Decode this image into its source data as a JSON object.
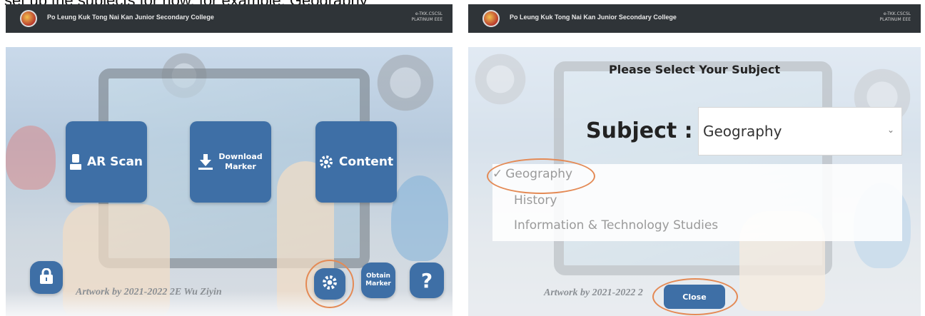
{
  "caption": "set up the subjects for now, for example, Geography",
  "app": {
    "school_name": "Po Leung Kuk Tong Nai Kan Junior Secondary College",
    "partner_line1": "e-TKK.CSCSL",
    "partner_line2": "PLATINUM EEE"
  },
  "home": {
    "tiles": {
      "ar_scan": "AR Scan",
      "download_line1": "Download",
      "download_line2": "Marker",
      "content": "Content"
    },
    "obtain_line1": "Obtain",
    "obtain_line2": "Marker",
    "help": "?",
    "artwork": "Artwork by 2021-2022 2E Wu Ziyin"
  },
  "dialog": {
    "title": "Please Select Your Subject",
    "subject_label": "Subject :",
    "selected": "Geography",
    "options": [
      "Geography",
      "History",
      "Information & Technology Studies"
    ],
    "close": "Close",
    "artwork": "Artwork by 2021-2022 2"
  },
  "colors": {
    "button": "#3e6fa6",
    "highlight_ring": "#e48a55",
    "topbar": "#2f3438"
  }
}
